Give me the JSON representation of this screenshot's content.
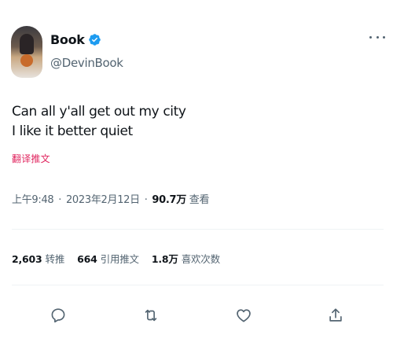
{
  "author": {
    "display_name": "Book",
    "handle": "@DevinBook",
    "verified": true,
    "avatar_icon": "profile-avatar-basketball-player"
  },
  "tweet": {
    "lines": [
      "Can all y'all get out my city",
      "I like it better quiet"
    ],
    "translate_label": "翻译推文"
  },
  "meta": {
    "time": "上午9:48",
    "date": "2023年2月12日",
    "views_count": "90.7万",
    "views_label": "查看"
  },
  "stats": {
    "retweets": {
      "count": "2,603",
      "label": "转推"
    },
    "quotes": {
      "count": "664",
      "label": "引用推文"
    },
    "likes": {
      "count": "1.8万",
      "label": "喜欢次数"
    }
  },
  "actions": [
    "reply-icon",
    "retweet-icon",
    "like-icon",
    "share-icon"
  ],
  "colors": {
    "text": "#0f1419",
    "secondary": "#536471",
    "verified": "#1d9bf0",
    "translate": "#e0245e",
    "divider": "#eff3f4"
  }
}
